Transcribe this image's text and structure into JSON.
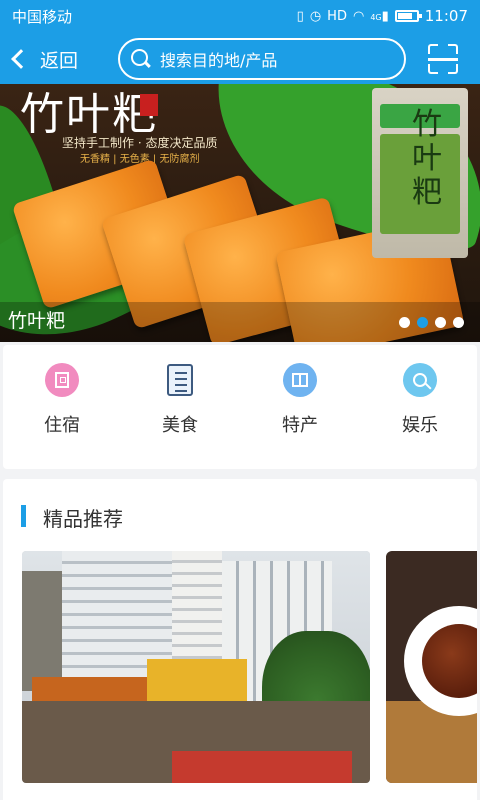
{
  "status_bar": {
    "carrier": "中国移动",
    "network": "4G",
    "time": "11:07"
  },
  "nav": {
    "back_label": "返回",
    "search_placeholder": "搜索目的地/产品"
  },
  "banner": {
    "caption": "竹叶粑",
    "brand_title": "竹叶粑",
    "brand_subtitle": "坚持手工制作 · 态度决定品质",
    "brand_tagline": "无香精 | 无色素 | 无防腐剂",
    "package_text": "竹叶粑",
    "slide_count": 4,
    "active_slide": 2
  },
  "categories": [
    {
      "label": "住宿",
      "icon": "hotel-icon"
    },
    {
      "label": "美食",
      "icon": "menu-book-icon"
    },
    {
      "label": "特产",
      "icon": "gift-icon"
    },
    {
      "label": "娱乐",
      "icon": "microphone-icon"
    }
  ],
  "featured": {
    "title": "精品推荐"
  },
  "colors": {
    "primary": "#1c9ee6",
    "hotel": "#f18bbf",
    "specialty": "#6fb3f0",
    "entertainment": "#6ec7ef"
  }
}
